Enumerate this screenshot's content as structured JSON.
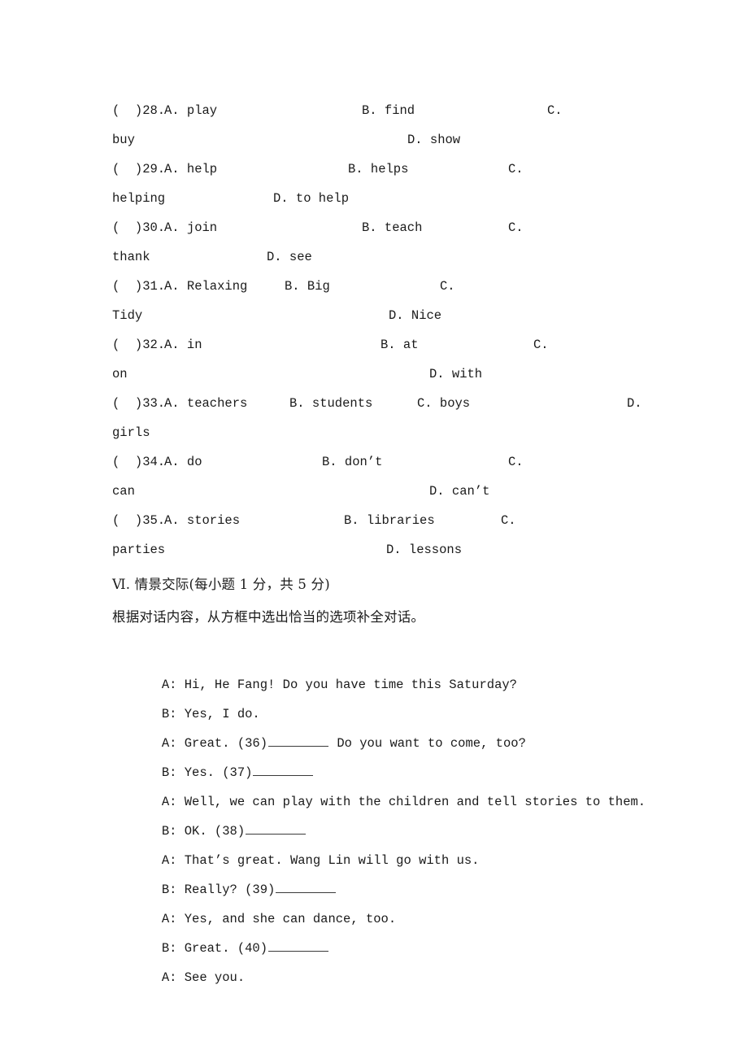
{
  "document": {
    "page_background": "#ffffff",
    "text_color": "#1a1a1a"
  },
  "multiple_choice": {
    "items": [
      {
        "marker": "(  )28.",
        "a": "A. play",
        "b": "B. find",
        "c_label": "C.",
        "c_word": "buy",
        "d": "D. show"
      },
      {
        "marker": "(  )29.",
        "a": "A. help",
        "b": "B. helps",
        "c_label": "C.",
        "c_word": "helping",
        "d": "D. to help"
      },
      {
        "marker": "(  )30.",
        "a": "A. join",
        "b": "B. teach",
        "c_label": "C.",
        "c_word": "thank",
        "d": "D. see"
      },
      {
        "marker": "(  )31.",
        "a": "A. Relaxing",
        "b": "B. Big",
        "c_label": "C.",
        "c_word": "Tidy",
        "d": "D. Nice"
      },
      {
        "marker": "(  )32.",
        "a": "A. in",
        "b": "B. at",
        "c_label": "C.",
        "c_word": "on",
        "d": "D. with"
      },
      {
        "marker": "(  )33.",
        "a": "A. teachers",
        "b": "B. students",
        "c_label": "C. boys",
        "c_word": "girls",
        "d": "D."
      },
      {
        "marker": "(  )34.",
        "a": "A. do",
        "b": "B. don’t",
        "c_label": "C.",
        "c_word": "can",
        "d": "D. can’t"
      },
      {
        "marker": "(  )35.",
        "a": "A. stories",
        "b": "B. libraries",
        "c_label": "C.",
        "c_word": "parties",
        "d": "D. lessons"
      }
    ]
  },
  "section": {
    "heading": "Ⅵ. 情景交际(每小题 1 分，共 5 分)",
    "instruction": "根据对话内容，从方框中选出恰当的选项补全对话。"
  },
  "dialogue": {
    "lines": [
      {
        "pre": "A: Hi, He Fang! Do you have time this Saturday?",
        "blank": false,
        "post": ""
      },
      {
        "pre": "B: Yes, I do.",
        "blank": false,
        "post": ""
      },
      {
        "pre": "A: Great. (36)",
        "blank": true,
        "post": " Do you want to come, too?"
      },
      {
        "pre": "B: Yes. (37)",
        "blank": true,
        "post": ""
      },
      {
        "pre": "A: Well, we can play with the children and tell stories to them.",
        "blank": false,
        "post": ""
      },
      {
        "pre": "B: OK. (38)",
        "blank": true,
        "post": ""
      },
      {
        "pre": "A: That’s great. Wang Lin will go with us.",
        "blank": false,
        "post": ""
      },
      {
        "pre": "B: Really? (39)",
        "blank": true,
        "post": ""
      },
      {
        "pre": "A: Yes, and she can dance, too.",
        "blank": false,
        "post": ""
      },
      {
        "pre": "B: Great. (40)",
        "blank": true,
        "post": ""
      },
      {
        "pre": "A: See you.",
        "blank": false,
        "post": ""
      }
    ]
  }
}
